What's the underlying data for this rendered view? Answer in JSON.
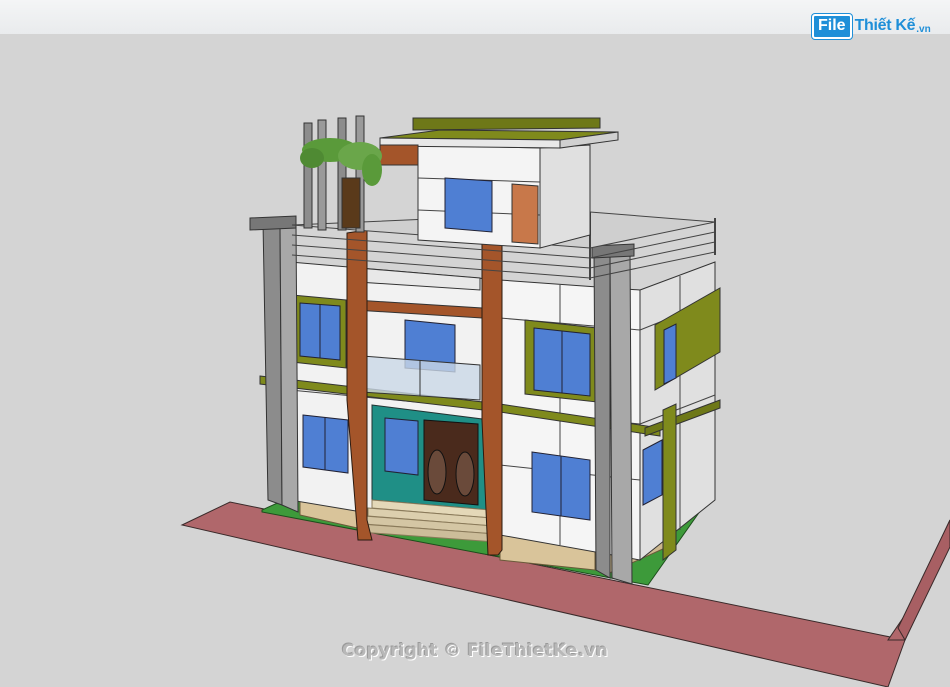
{
  "logo": {
    "brand_file": "File",
    "brand_rest": "Thiết Kế",
    "brand_tld": ".vn"
  },
  "watermark": {
    "text": "Copyright © FileThietKe.vn"
  },
  "colors": {
    "viewport_bg": "#d4d4d4",
    "wall": "#f2f2f2",
    "wall_shade": "#e0e0e0",
    "trim_olive": "#7f8a1c",
    "wood": "#a4552a",
    "column_gray": "#8c8c8c",
    "glass": "#4f7fd3",
    "teal": "#1f8f86",
    "sidewalk": "#b0676b",
    "grass": "#3d9a3a",
    "stone": "#d9c49a",
    "brand_blue": "#1f8fd8"
  }
}
